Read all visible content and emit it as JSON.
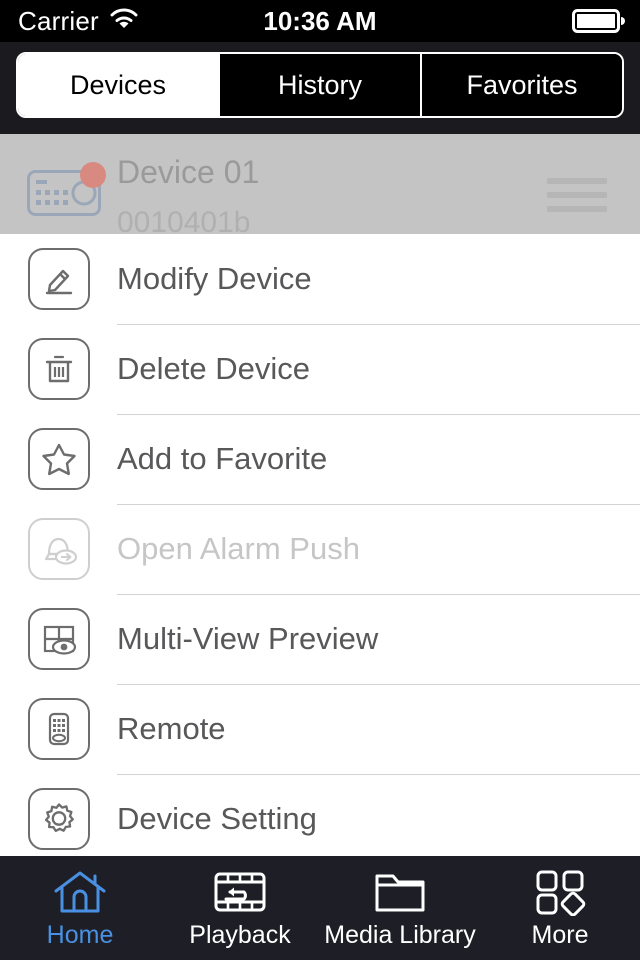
{
  "statusbar": {
    "carrier": "Carrier",
    "wifi_icon": "wifi-icon",
    "time": "10:36 AM",
    "battery_icon": "battery-full-icon"
  },
  "segmented_control": {
    "selected": "Devices",
    "items": [
      {
        "label": "Devices",
        "active": true
      },
      {
        "label": "History",
        "active": false
      },
      {
        "label": "Favorites",
        "active": false
      }
    ]
  },
  "device_row": {
    "name": "Device 01",
    "id": "0010401b",
    "thumb_icon": "dvr-device-icon",
    "status_dot_color": "#d98a80",
    "reorder_icon": "reorder-handle-icon"
  },
  "action_sheet": {
    "items": [
      {
        "label": "Modify Device",
        "icon": "pencil-icon",
        "disabled": false
      },
      {
        "label": "Delete Device",
        "icon": "trash-icon",
        "disabled": false
      },
      {
        "label": "Add to Favorite",
        "icon": "star-icon",
        "disabled": false
      },
      {
        "label": "Open Alarm Push",
        "icon": "alarm-push-icon",
        "disabled": true
      },
      {
        "label": "Multi-View Preview",
        "icon": "multi-view-icon",
        "disabled": false
      },
      {
        "label": "Remote",
        "icon": "remote-icon",
        "disabled": false
      },
      {
        "label": "Device Setting",
        "icon": "gear-icon",
        "disabled": false
      }
    ]
  },
  "tabbar": {
    "active_color": "#4a90e2",
    "items": [
      {
        "label": "Home",
        "icon": "home-icon",
        "active": true
      },
      {
        "label": "Playback",
        "icon": "playback-icon",
        "active": false
      },
      {
        "label": "Media Library",
        "icon": "folder-icon",
        "active": false
      },
      {
        "label": "More",
        "icon": "more-grid-icon",
        "active": false
      }
    ]
  }
}
